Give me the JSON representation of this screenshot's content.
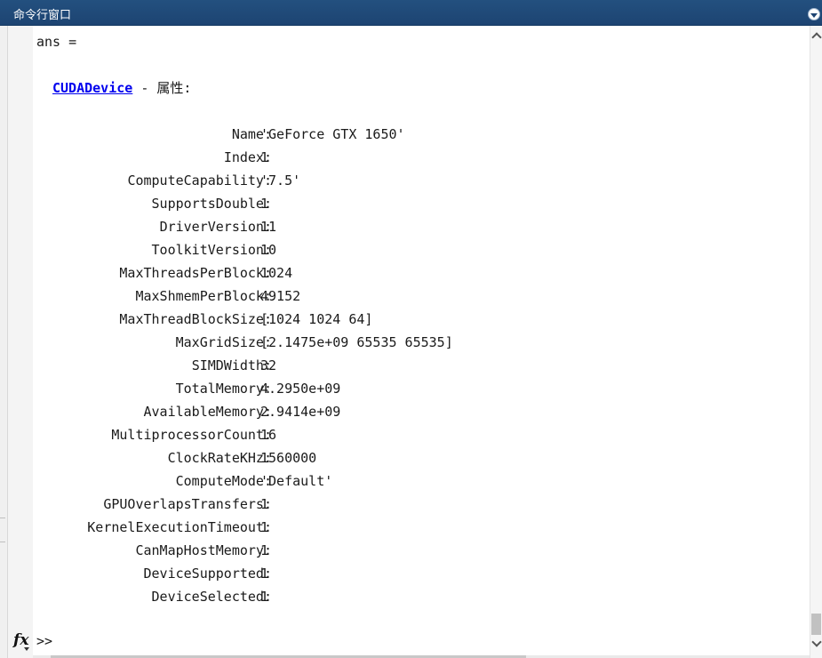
{
  "window": {
    "title": "命令行窗口",
    "menu_icon": "chevron-down-circle-icon"
  },
  "output": {
    "ans_line": "ans =",
    "class_link": "CUDADevice",
    "class_suffix": " - 属性:",
    "properties": [
      {
        "name": "Name",
        "value": "'GeForce GTX 1650'"
      },
      {
        "name": "Index",
        "value": "1"
      },
      {
        "name": "ComputeCapability",
        "value": "'7.5'"
      },
      {
        "name": "SupportsDouble",
        "value": "1"
      },
      {
        "name": "DriverVersion",
        "value": "11"
      },
      {
        "name": "ToolkitVersion",
        "value": "10"
      },
      {
        "name": "MaxThreadsPerBlock",
        "value": "1024"
      },
      {
        "name": "MaxShmemPerBlock",
        "value": "49152"
      },
      {
        "name": "MaxThreadBlockSize",
        "value": "[1024 1024 64]"
      },
      {
        "name": "MaxGridSize",
        "value": "[2.1475e+09 65535 65535]"
      },
      {
        "name": "SIMDWidth",
        "value": "32"
      },
      {
        "name": "TotalMemory",
        "value": "4.2950e+09"
      },
      {
        "name": "AvailableMemory",
        "value": "2.9414e+09"
      },
      {
        "name": "MultiprocessorCount",
        "value": "16"
      },
      {
        "name": "ClockRateKHz",
        "value": "1560000"
      },
      {
        "name": "ComputeMode",
        "value": "'Default'"
      },
      {
        "name": "GPUOverlapsTransfers",
        "value": "1"
      },
      {
        "name": "KernelExecutionTimeout",
        "value": "1"
      },
      {
        "name": "CanMapHostMemory",
        "value": "1"
      },
      {
        "name": "DeviceSupported",
        "value": "1"
      },
      {
        "name": "DeviceSelected",
        "value": "1"
      }
    ]
  },
  "prompt": {
    "fx_label": "fx",
    "symbol": ">>"
  }
}
